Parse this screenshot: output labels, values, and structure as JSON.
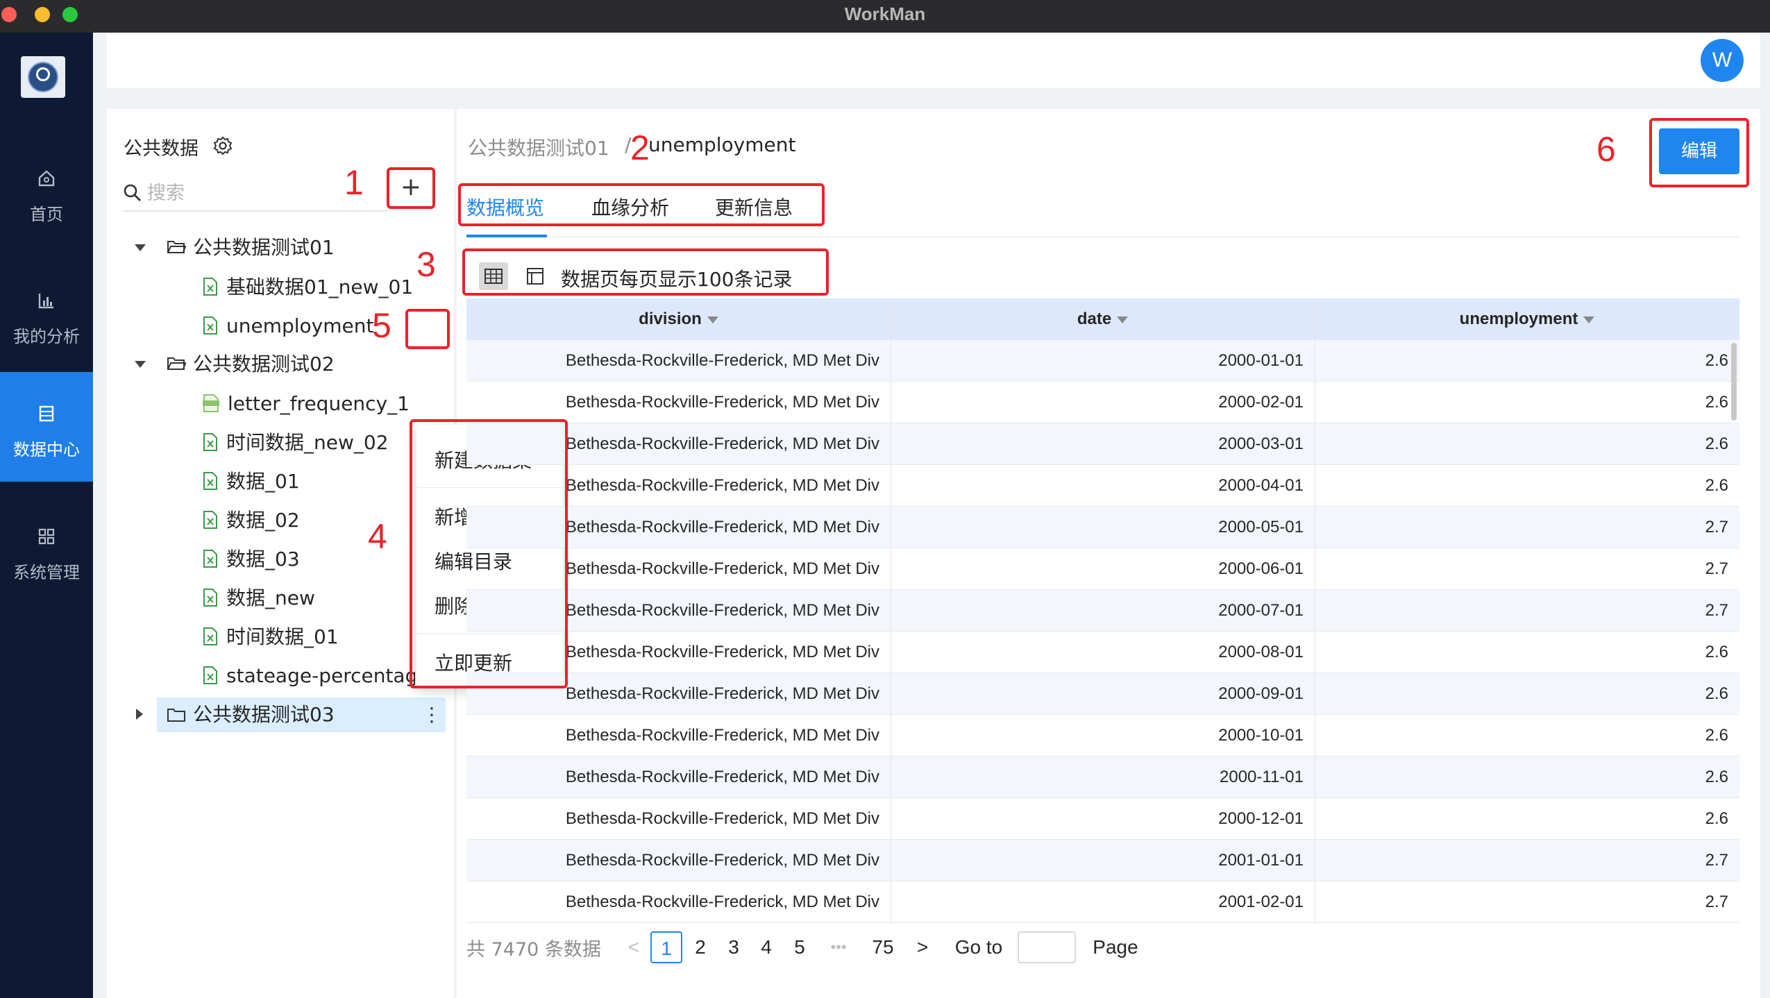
{
  "window": {
    "title": "WorkMan"
  },
  "nav": {
    "items": [
      {
        "label": "首页",
        "icon": "home-icon",
        "active": false
      },
      {
        "label": "我的分析",
        "icon": "bar-chart-icon",
        "active": false
      },
      {
        "label": "数据中心",
        "icon": "database-icon",
        "active": true
      },
      {
        "label": "系统管理",
        "icon": "grid-icon",
        "active": false
      }
    ]
  },
  "header": {
    "avatar_letter": "W"
  },
  "tree": {
    "title": "公共数据",
    "search_placeholder": "搜索",
    "add_label": "+",
    "nodes": [
      {
        "label": "公共数据测试01",
        "type": "folder",
        "expanded": true
      },
      {
        "label": "基础数据01_new_01",
        "type": "file"
      },
      {
        "label": "unemployment",
        "type": "file"
      },
      {
        "label": "公共数据测试02",
        "type": "folder",
        "expanded": true
      },
      {
        "label": "letter_frequency_1",
        "type": "json-file"
      },
      {
        "label": "时间数据_new_02",
        "type": "file"
      },
      {
        "label": "数据_01",
        "type": "file"
      },
      {
        "label": "数据_02",
        "type": "file"
      },
      {
        "label": "数据_03",
        "type": "file"
      },
      {
        "label": "数据_new",
        "type": "file"
      },
      {
        "label": "时间数据_01",
        "type": "file"
      },
      {
        "label": "stateage-percentage",
        "type": "file"
      },
      {
        "label": "公共数据测试03",
        "type": "folder",
        "expanded": false,
        "selected": true
      }
    ],
    "kebab": "⋮"
  },
  "context_menu": {
    "items": [
      "新建数据集",
      "新增目录",
      "编辑目录",
      "删除目录",
      "立即更新"
    ]
  },
  "breadcrumb": {
    "parent": "公共数据测试01",
    "separator": "/",
    "current": "unemployment"
  },
  "edit_label": "编辑",
  "tabs": [
    {
      "label": "数据概览",
      "active": true
    },
    {
      "label": "血缘分析",
      "active": false
    },
    {
      "label": "更新信息",
      "active": false
    }
  ],
  "view_note": "数据页每页显示100条记录",
  "table": {
    "columns": [
      "division",
      "date",
      "unemployment"
    ],
    "rows": [
      [
        "Bethesda-Rockville-Frederick, MD Met Div",
        "2000-01-01",
        "2.6"
      ],
      [
        "Bethesda-Rockville-Frederick, MD Met Div",
        "2000-02-01",
        "2.6"
      ],
      [
        "Bethesda-Rockville-Frederick, MD Met Div",
        "2000-03-01",
        "2.6"
      ],
      [
        "Bethesda-Rockville-Frederick, MD Met Div",
        "2000-04-01",
        "2.6"
      ],
      [
        "Bethesda-Rockville-Frederick, MD Met Div",
        "2000-05-01",
        "2.7"
      ],
      [
        "Bethesda-Rockville-Frederick, MD Met Div",
        "2000-06-01",
        "2.7"
      ],
      [
        "Bethesda-Rockville-Frederick, MD Met Div",
        "2000-07-01",
        "2.7"
      ],
      [
        "Bethesda-Rockville-Frederick, MD Met Div",
        "2000-08-01",
        "2.6"
      ],
      [
        "Bethesda-Rockville-Frederick, MD Met Div",
        "2000-09-01",
        "2.6"
      ],
      [
        "Bethesda-Rockville-Frederick, MD Met Div",
        "2000-10-01",
        "2.6"
      ],
      [
        "Bethesda-Rockville-Frederick, MD Met Div",
        "2000-11-01",
        "2.6"
      ],
      [
        "Bethesda-Rockville-Frederick, MD Met Div",
        "2000-12-01",
        "2.6"
      ],
      [
        "Bethesda-Rockville-Frederick, MD Met Div",
        "2001-01-01",
        "2.7"
      ],
      [
        "Bethesda-Rockville-Frederick, MD Met Div",
        "2001-02-01",
        "2.7"
      ]
    ]
  },
  "pagination": {
    "total": "共 7470 条数据",
    "prev": "<",
    "pages": [
      "1",
      "2",
      "3",
      "4",
      "5",
      "•••",
      "75"
    ],
    "current": "1",
    "next": ">",
    "goto_label": "Go to",
    "page_label": "Page"
  },
  "annotations": [
    "1",
    "2",
    "3",
    "4",
    "5",
    "6"
  ],
  "colors": {
    "accent": "#1f86f0",
    "nav_bg": "#0e1a33",
    "annotation": "#e8232a",
    "selected_bg": "#dbeeff"
  }
}
